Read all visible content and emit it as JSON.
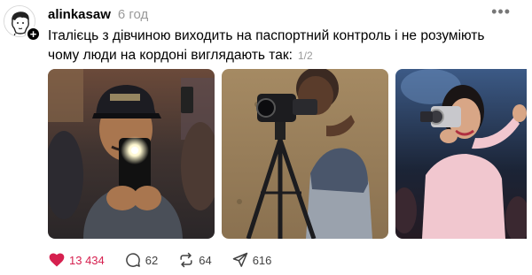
{
  "post": {
    "username": "alinkasaw",
    "time": "6 год",
    "more_icon": "more-horizontal-icon",
    "text": "Італієць з дівчиною виходить на паспортний контроль і не розуміють чому люди на кордоні виглядають так:",
    "counter": "1/2"
  },
  "media": {
    "photos": [
      "photo-phone-recording",
      "photo-camcorder-tripod",
      "photo-camcorder-handheld"
    ]
  },
  "actions": {
    "likes": "13 434",
    "comments": "62",
    "reposts": "64",
    "shares": "616"
  },
  "colors": {
    "like": "#d6204f",
    "muted": "#9a9a9a"
  }
}
